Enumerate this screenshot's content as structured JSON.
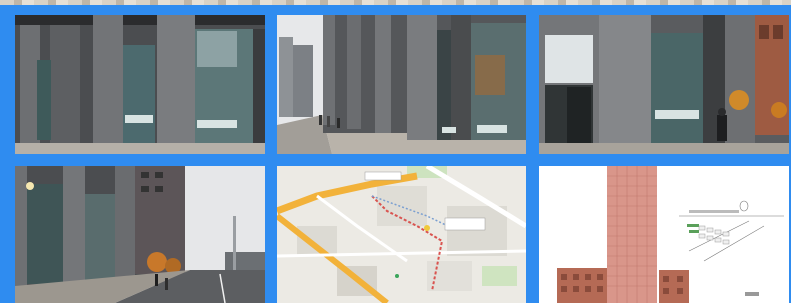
{
  "gallery": {
    "thumbnails": [
      {
        "id": "photo-storefront-corner",
        "icon": "photo"
      },
      {
        "id": "photo-street-towers",
        "icon": "photo"
      },
      {
        "id": "photo-entrance-door",
        "icon": "photo"
      },
      {
        "id": "photo-sidewalk-road",
        "icon": "photo"
      },
      {
        "id": "map-route",
        "icon": "map"
      },
      {
        "id": "building-elevation-plan",
        "icon": "drawing"
      }
    ]
  },
  "colors": {
    "background": "#2f8cf0",
    "brick_dark": "#4a4c4f",
    "glass": "#3d5a5a",
    "sky": "#e4e6e8",
    "map_road": "#f2b23a",
    "route": "#d9534f",
    "tower_pink": "#d9968a",
    "tower_brick": "#b56a55"
  }
}
